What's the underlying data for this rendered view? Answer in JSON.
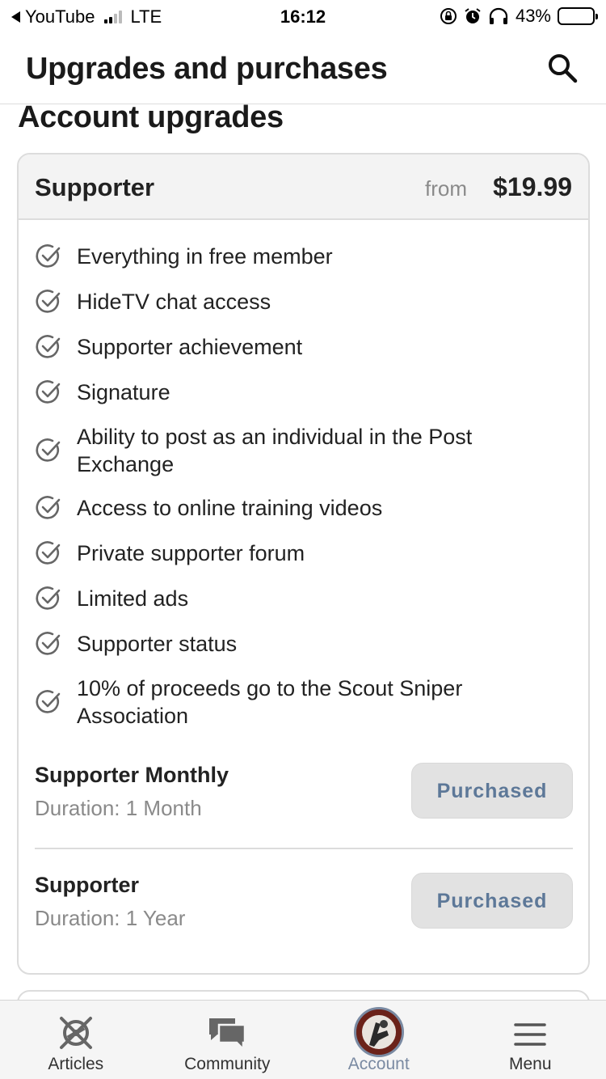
{
  "status_bar": {
    "back_app": "YouTube",
    "network": "LTE",
    "time": "16:12",
    "battery_percent": "43%",
    "signal_bars": 2,
    "battery_level": 0.43
  },
  "header": {
    "title": "Upgrades and purchases",
    "search_icon": "search-icon"
  },
  "section_title": "Account upgrades",
  "plan": {
    "name": "Supporter",
    "price_prefix": "from",
    "price": "$19.99",
    "features": [
      "Everything in free member",
      "HideTV chat access",
      "Supporter achievement",
      "Signature",
      "Ability to post as an individual in the Post Exchange",
      "Access to online training videos",
      "Private supporter forum",
      "Limited ads",
      "Supporter status",
      "10% of proceeds go to the Scout Sniper Association"
    ],
    "options": [
      {
        "name": "Supporter Monthly",
        "duration": "Duration: 1 Month",
        "button": "Purchased"
      },
      {
        "name": "Supporter",
        "duration": "Duration: 1 Year",
        "button": "Purchased"
      }
    ]
  },
  "tab_bar": {
    "tabs": [
      {
        "label": "Articles",
        "icon": "articles-logo-icon",
        "active": false
      },
      {
        "label": "Community",
        "icon": "chat-bubbles-icon",
        "active": false
      },
      {
        "label": "Account",
        "icon": "avatar",
        "active": true
      },
      {
        "label": "Menu",
        "icon": "hamburger-menu-icon",
        "active": false
      }
    ]
  },
  "colors": {
    "accent": "#7a8aa2",
    "purchased_text": "#5d7898",
    "purchased_bg": "#e2e2e2",
    "card_border": "#dcdcdc",
    "muted_text": "#8a8a8a"
  }
}
